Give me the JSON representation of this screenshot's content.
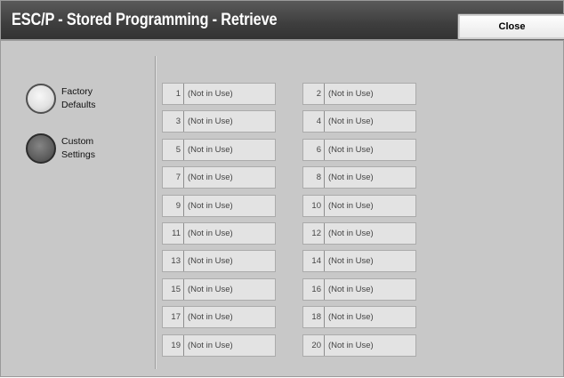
{
  "header": {
    "title": "ESC/P - Stored Programming - Retrieve",
    "close_label": "Close"
  },
  "options": [
    {
      "label_line1": "Factory",
      "label_line2": "Defaults",
      "selected": false
    },
    {
      "label_line1": "Custom",
      "label_line2": "Settings",
      "selected": true
    }
  ],
  "slots": [
    {
      "number": "1",
      "label": "(Not in Use)"
    },
    {
      "number": "2",
      "label": "(Not in Use)"
    },
    {
      "number": "3",
      "label": "(Not in Use)"
    },
    {
      "number": "4",
      "label": "(Not in Use)"
    },
    {
      "number": "5",
      "label": "(Not in Use)"
    },
    {
      "number": "6",
      "label": "(Not in Use)"
    },
    {
      "number": "7",
      "label": "(Not in Use)"
    },
    {
      "number": "8",
      "label": "(Not in Use)"
    },
    {
      "number": "9",
      "label": "(Not in Use)"
    },
    {
      "number": "10",
      "label": "(Not in Use)"
    },
    {
      "number": "11",
      "label": "(Not in Use)"
    },
    {
      "number": "12",
      "label": "(Not in Use)"
    },
    {
      "number": "13",
      "label": "(Not in Use)"
    },
    {
      "number": "14",
      "label": "(Not in Use)"
    },
    {
      "number": "15",
      "label": "(Not in Use)"
    },
    {
      "number": "16",
      "label": "(Not in Use)"
    },
    {
      "number": "17",
      "label": "(Not in Use)"
    },
    {
      "number": "18",
      "label": "(Not in Use)"
    },
    {
      "number": "19",
      "label": "(Not in Use)"
    },
    {
      "number": "20",
      "label": "(Not in Use)"
    }
  ],
  "colors": {
    "panel_background": "#c8c8c8",
    "title_bar": "#404040",
    "slot_background": "#e3e3e3"
  }
}
